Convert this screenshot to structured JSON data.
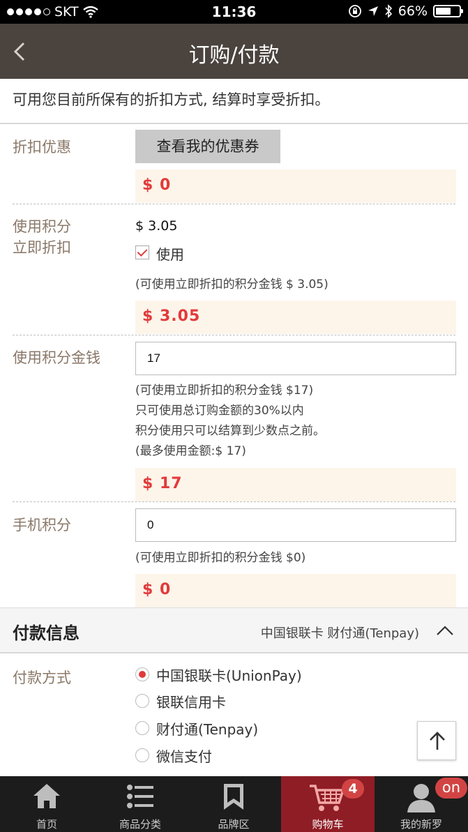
{
  "status_bar": {
    "carrier": "SKT",
    "time": "11:36",
    "battery": "66%",
    "battery_fraction": 0.66
  },
  "header": {
    "title": "订购/付款"
  },
  "intro": "可用您目前所保有的折扣方式, 结算时享受折扣。",
  "discount": {
    "label": "折扣优惠",
    "button": "查看我的优惠券",
    "amount": "$ 0"
  },
  "points_instant": {
    "label_line1": "使用积分",
    "label_line2": "立即折扣",
    "value": "$ 3.05",
    "checkbox_label": "使用",
    "checked": true,
    "note": "(可使用立即折扣的积分金钱 $ 3.05)",
    "amount": "$ 3.05"
  },
  "points_money": {
    "label": "使用积分金钱",
    "input_value": "17",
    "notes": [
      "(可使用立即折扣的积分金钱 $17)",
      "只可使用总订购金额的30%以内",
      "积分使用只可以结算到少数点之前。",
      "(最多使用金额:$ 17)"
    ],
    "amount": "$ 17"
  },
  "mobile_points": {
    "label": "手机积分",
    "input_value": "0",
    "note": "(可使用立即折扣的积分金钱 $0)",
    "amount": "$ 0"
  },
  "payment": {
    "title": "付款信息",
    "summary": "中国银联卡 财付通(Tenpay)",
    "method_label": "付款方式",
    "options": [
      {
        "label": "中国银联卡(UnionPay)",
        "selected": true
      },
      {
        "label": "银联信用卡",
        "selected": false
      },
      {
        "label": "财付通(Tenpay)",
        "selected": false
      },
      {
        "label": "微信支付",
        "selected": false
      }
    ]
  },
  "tabbar": {
    "items": [
      {
        "label": "首页",
        "icon": "home-icon"
      },
      {
        "label": "商品分类",
        "icon": "list-icon"
      },
      {
        "label": "品牌区",
        "icon": "bookmark-icon"
      },
      {
        "label": "购物车",
        "icon": "cart-icon",
        "active": true
      },
      {
        "label": "我的新罗",
        "icon": "user-icon"
      }
    ],
    "cart_badge": "4",
    "user_badge": "on"
  },
  "colors": {
    "header_bg": "#4a433e",
    "accent_red": "#e13b3b",
    "active_tab": "#8f1d25",
    "label_brown": "#8a7868"
  }
}
